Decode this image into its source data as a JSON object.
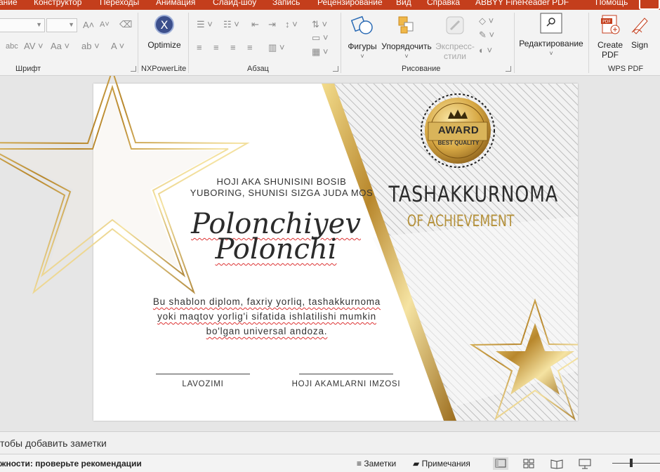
{
  "menu": {
    "items": [
      "ание",
      "Конструктор",
      "Переходы",
      "Анимация",
      "Слайд-шоу",
      "Запись",
      "Рецензирование",
      "Вид",
      "Справка",
      "ABBYY FineReader PDF",
      "Помощь"
    ]
  },
  "ribbon": {
    "groups": {
      "font": "Шрифт",
      "nxpower": "NXPowerLite",
      "paragraph": "Абзац",
      "drawing": "Рисование",
      "wps": "WPS PDF"
    },
    "buttons": {
      "optimize": "Optimize",
      "shapes": "Фигуры",
      "arrange": "Упорядочить",
      "express_styles_1": "Экспресс-",
      "express_styles_2": "стили",
      "editing": "Редактирование",
      "create_pdf_1": "Create",
      "create_pdf_2": "PDF",
      "sign": "Sign"
    }
  },
  "slide": {
    "subtitle_line1": "HOJI AKA SHUNISINI BOSIB",
    "subtitle_line2": "YUBORING, SHUNISI SIZGA JUDA MOS",
    "recipient_line1": "Polonchiyev",
    "recipient_line2": "Polonchi",
    "description": "Bu shablon diplom, faxriy yorliq, tashakkurnoma yoki maqtov yorlig'i sifatida ishlatilishi mumkin bo'lgan universal andoza.",
    "signature_left": "LAVOZIMI",
    "signature_right": "HOJI AKAMLARNI IMZOSI",
    "title": "TASHAKKURNOMA",
    "title_sub": "OF ACHIEVEMENT",
    "badge_main": "AWARD",
    "badge_sub": "BEST QUALITY"
  },
  "notes": {
    "placeholder": "тобы добавить заметки"
  },
  "status": {
    "accessibility": "жности: проверьте рекомендации",
    "notes_button": "Заметки",
    "comments_button": "Примечания"
  },
  "colors": {
    "accent": "#c43e1c",
    "gold": "#b5913a"
  }
}
